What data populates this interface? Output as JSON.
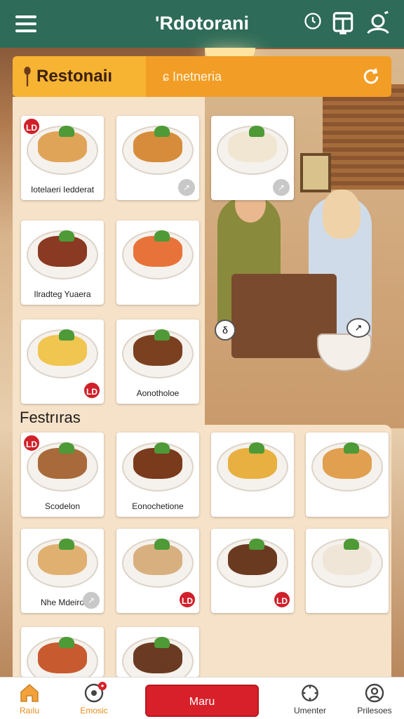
{
  "header": {
    "title": "'Rdotorani",
    "icons": [
      "menu-icon",
      "clock-icon",
      "chart-icon",
      "profile-icon"
    ]
  },
  "section": {
    "title": "Restonaiı",
    "filter": "ɕ Inetneria"
  },
  "cards_top": [
    {
      "label": "Iotelaeri Iedderat",
      "badge": "LD",
      "food_color": "#e0a458"
    },
    {
      "label": "",
      "icon": "↗",
      "food_color": "#d68c3a"
    },
    {
      "label": "",
      "icon": "↗",
      "food_color": "#f0e6d2"
    },
    {
      "label": "Ilradteg Yuaera",
      "food_color": "#8a3a22"
    },
    {
      "label": "",
      "food_color": "#e8733a"
    },
    {
      "label": "",
      "badge": "LD",
      "food_color": "#f0c550"
    },
    {
      "label": "Aonotholoe",
      "food_color": "#7a4020"
    }
  ],
  "features": {
    "heading": "Festrıras"
  },
  "cards_bottom": [
    {
      "label": "Scodelon",
      "badge": "LD",
      "food_color": "#a86a3a"
    },
    {
      "label": "Eonochetione",
      "food_color": "#7a3a1c"
    },
    {
      "label": "",
      "food_color": "#e8b040"
    },
    {
      "label": "",
      "food_color": "#e0a050"
    },
    {
      "label": "Nhe Mdeiro",
      "icon": "↗",
      "food_color": "#e0b070"
    },
    {
      "label": "",
      "badge": "LD",
      "food_color": "#d8b080"
    },
    {
      "label": "",
      "badge": "LD",
      "food_color": "#6a3a20"
    },
    {
      "label": "",
      "food_color": "#f0e6d8"
    },
    {
      "label": "",
      "food_color": "#c85a30"
    },
    {
      "label": "",
      "food_color": "#6a3a22"
    }
  ],
  "scene": {
    "marker1": "δ",
    "marker2": "↗"
  },
  "bottom_nav": {
    "home": "Raılu",
    "discover": "Emosic",
    "menu_button": "Maru",
    "favorites": "Umenter",
    "profile": "Prilesoes",
    "notify_badge": "●"
  },
  "colors": {
    "header_bg": "#2e6b58",
    "accent_orange": "#f29d25",
    "accent_red": "#d8202a",
    "panel_bg": "#f6e2c8"
  }
}
